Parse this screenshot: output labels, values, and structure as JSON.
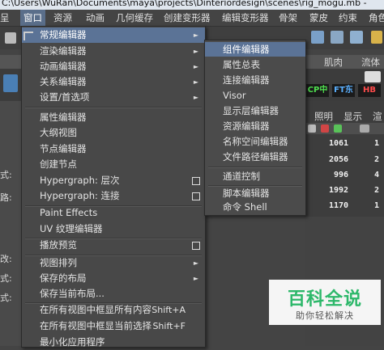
{
  "title_bar": {
    "text": "C:\\Users\\WuRan\\Documents\\maya\\projects\\Dinteriordesign\\scenes\\rig_mogu.mb   -"
  },
  "menubar": {
    "items": [
      "呈",
      "窗口",
      "资源",
      "动画",
      "几何缓存",
      "创建变形器",
      "编辑变形器",
      "骨架",
      "蒙皮",
      "约束",
      "角色"
    ]
  },
  "shelf_tabs": [
    "肌肉",
    "流体"
  ],
  "shelf_labels": [
    "CP中",
    "FT东",
    "HB"
  ],
  "left_strip": {
    "labels": [
      "式:",
      "路:",
      "改:",
      "式:",
      "式:"
    ]
  },
  "channel_box": {
    "headers": [
      "照明",
      "显示",
      "渲"
    ],
    "values": [
      "1061",
      "2056",
      "996",
      "1992",
      "1170"
    ],
    "suffix": [
      "1",
      "2",
      "4",
      "2",
      "1"
    ]
  },
  "window_menu": {
    "items": [
      {
        "label": "常规编辑器",
        "arrow": true,
        "highlighted": true
      },
      {
        "label": "渲染编辑器",
        "arrow": true
      },
      {
        "label": "动画编辑器",
        "arrow": true
      },
      {
        "label": "关系编辑器",
        "arrow": true
      },
      {
        "label": "设置/首选项",
        "arrow": true
      },
      {
        "separator": true
      },
      {
        "label": "属性编辑器"
      },
      {
        "label": "大纲视图"
      },
      {
        "label": "节点编辑器"
      },
      {
        "label": "创建节点"
      },
      {
        "label": "Hypergraph: 层次",
        "option": true
      },
      {
        "label": "Hypergraph: 连接",
        "option": true
      },
      {
        "separator": true
      },
      {
        "label": "Paint Effects"
      },
      {
        "label": "UV 纹理编辑器"
      },
      {
        "separator": true
      },
      {
        "label": "播放预览",
        "option": true
      },
      {
        "separator": true
      },
      {
        "label": "视图排列",
        "arrow": true
      },
      {
        "label": "保存的布局",
        "arrow": true
      },
      {
        "label": "保存当前布局..."
      },
      {
        "separator": true
      },
      {
        "label": "在所有视图中框显所有内容",
        "shortcut": "Shift+A"
      },
      {
        "label": "在所有视图中框显当前选择",
        "shortcut": "Shift+F"
      },
      {
        "label": "最小化应用程序"
      }
    ]
  },
  "general_editors_submenu": {
    "items": [
      {
        "label": "组件编辑器",
        "highlighted": true
      },
      {
        "label": "属性总表"
      },
      {
        "label": "连接编辑器"
      },
      {
        "label": "Visor"
      },
      {
        "label": "显示层编辑器"
      },
      {
        "label": "资源编辑器"
      },
      {
        "label": "名称空间编辑器"
      },
      {
        "label": "文件路径编辑器"
      },
      {
        "separator": true
      },
      {
        "label": "通道控制"
      },
      {
        "separator": true
      },
      {
        "label": "脚本编辑器"
      },
      {
        "label": "命令 Shell"
      }
    ]
  },
  "watermark": {
    "title": "百科全说",
    "subtitle": "助你轻松解决"
  },
  "colors": {
    "menu_highlight": "#5b7396",
    "menu_bg": "#484848",
    "watermark_green": "#2db86a"
  }
}
